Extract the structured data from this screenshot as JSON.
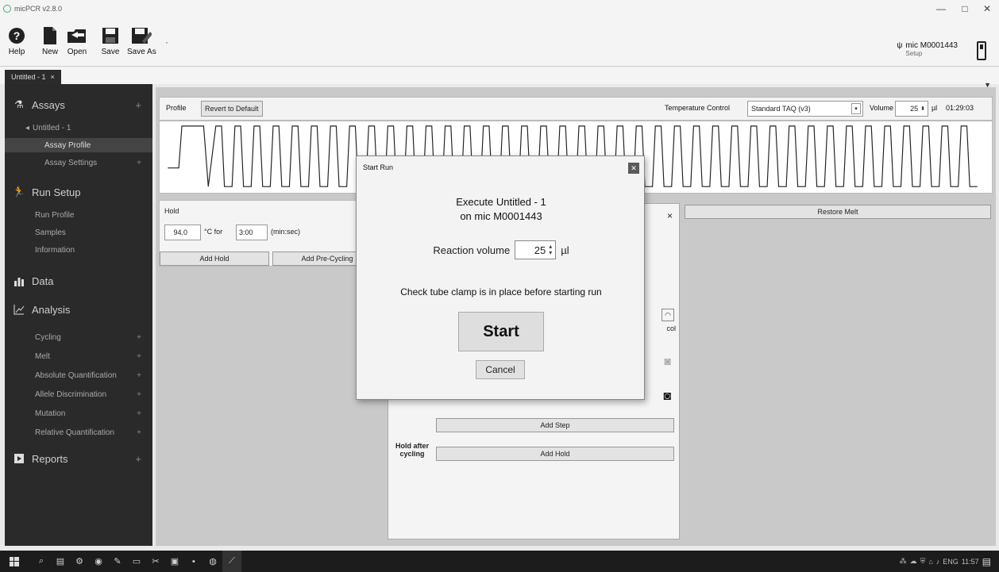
{
  "app": {
    "title": "micPCR v2.8.0"
  },
  "toolbar": {
    "help_label": "Help",
    "new_label": "New",
    "open_label": "Open",
    "save_label": "Save",
    "saveas_label": "Save As"
  },
  "device": {
    "name": "mic M0001443",
    "status": "Setup"
  },
  "doc_tab": {
    "label": "Untitled - 1",
    "close": "×"
  },
  "sidebar": {
    "assays": "Assays",
    "assay_name": "Untitled - 1",
    "assay_profile": "Assay Profile",
    "assay_settings": "Assay Settings",
    "run_setup": "Run Setup",
    "run_profile": "Run Profile",
    "samples": "Samples",
    "information": "Information",
    "data": "Data",
    "analysis": "Analysis",
    "cycling": "Cycling",
    "melt": "Melt",
    "absolute_quant": "Absolute Quantification",
    "allele_disc": "Allele Discrimination",
    "mutation": "Mutation",
    "relative_quant": "Relative Quantification",
    "reports": "Reports",
    "plus": "+"
  },
  "profile_bar": {
    "profile_label": "Profile",
    "revert_label": "Revert to Default",
    "temp_control_label": "Temperature Control",
    "temp_control_value": "Standard TAQ (v3)",
    "volume_label": "Volume",
    "volume_value": "25",
    "volume_unit": "µl",
    "duration": "01:29:03"
  },
  "hold": {
    "title": "Hold",
    "temp_value": "94.0",
    "temp_unit": "°C for",
    "time_value": "3:00",
    "time_unit": "(min:sec)",
    "add_hold": "Add Hold",
    "add_precycling": "Add Pre-Cycling"
  },
  "step_panel": {
    "close": "×",
    "col_label": "col",
    "add_step": "Add Step",
    "hold_after_label": "Hold after cycling",
    "add_hold": "Add Hold"
  },
  "restore_melt": "Restore Melt",
  "dialog": {
    "title": "Start Run",
    "line1": "Execute Untitled - 1",
    "line2": "on mic M0001443",
    "reaction_label": "Reaction volume",
    "reaction_value": "25",
    "reaction_unit": "µl",
    "check_text": "Check tube clamp is in place before starting run",
    "start_label": "Start",
    "cancel_label": "Cancel"
  },
  "taskbar": {
    "lang": "ENG",
    "time": "11:57"
  },
  "wave": {
    "cycles": 40
  }
}
